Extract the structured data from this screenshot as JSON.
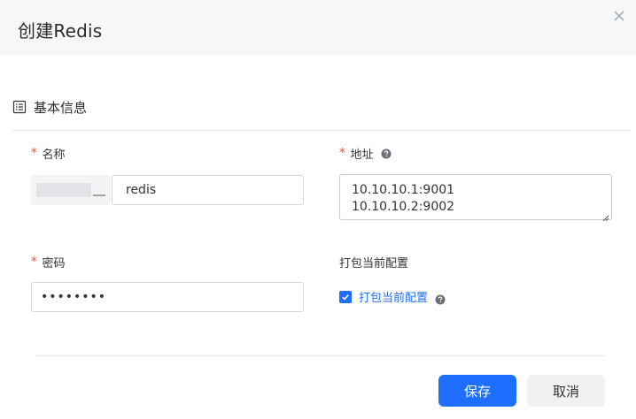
{
  "dialog": {
    "title": "创建Redis"
  },
  "section": {
    "title": "基本信息"
  },
  "form": {
    "name": {
      "label": "名称",
      "required_mark": "*",
      "prefix_suffix": "__",
      "value": "redis"
    },
    "address": {
      "label": "地址",
      "required_mark": "*",
      "lines": [
        "10.10.10.1:9001",
        "10.10.10.2:9002"
      ]
    },
    "password": {
      "label": "密码",
      "required_mark": "*",
      "masked_value": "••••••••"
    },
    "pack": {
      "label": "打包当前配置",
      "checkbox_label": "打包当前配置",
      "checked": true
    }
  },
  "footer": {
    "save_label": "保存",
    "cancel_label": "取消"
  },
  "colors": {
    "primary": "#1e6fff",
    "required": "#e34d4d",
    "header_bg": "#f6f7f9"
  },
  "icons": {
    "close": "close-icon",
    "section": "list-icon",
    "help": "question-circle-icon",
    "check": "check-icon"
  }
}
